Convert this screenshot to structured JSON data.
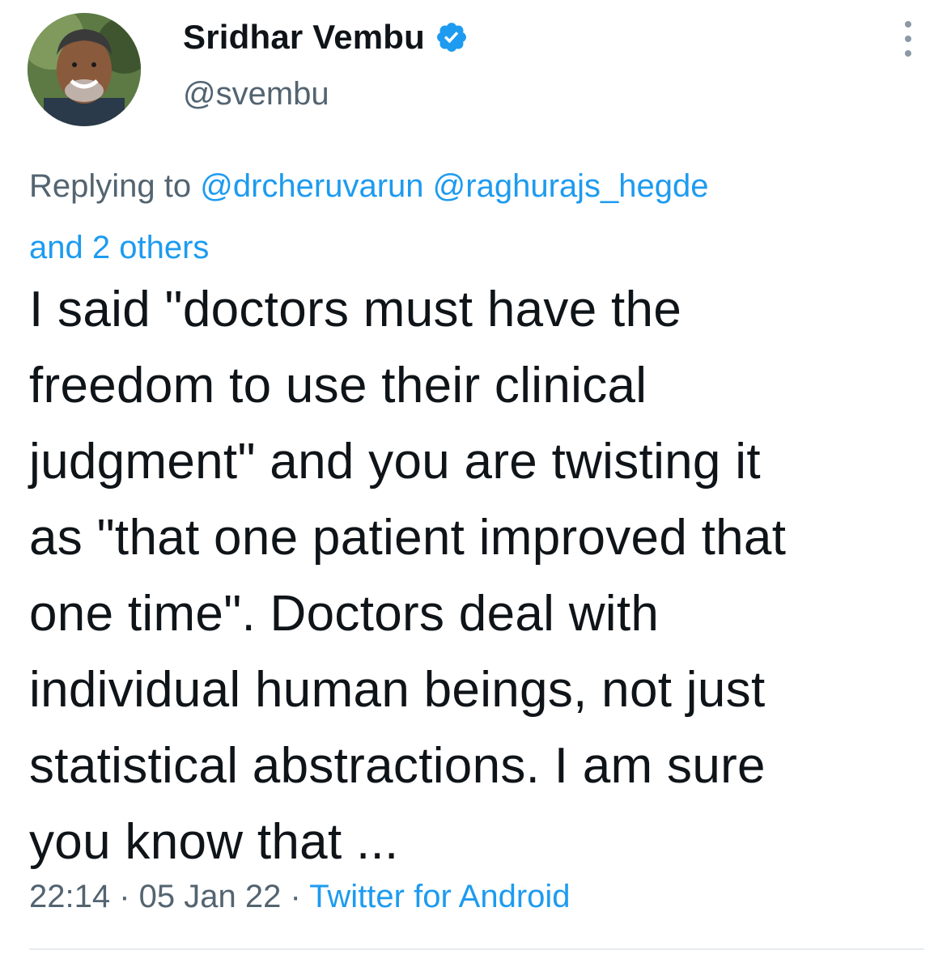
{
  "author": {
    "display_name": "Sridhar Vembu",
    "handle": "@svembu",
    "verified_icon": "verified-badge-icon",
    "verified_color": "#1d9bf0"
  },
  "reply": {
    "prefix": "Replying to ",
    "mentions": [
      "@drcheruvarun",
      "@raghurajs_hegde"
    ],
    "others": "and 2 others"
  },
  "tweet": {
    "lines": [
      "I said \"doctors must have the",
      "freedom to use their clinical",
      "judgment\" and you are twisting it",
      "as \"that one patient improved that",
      "one time\". Doctors deal with",
      "individual human beings, not just",
      "statistical abstractions. I am sure",
      "you know that ..."
    ]
  },
  "meta": {
    "time": "22:14",
    "separator": " · ",
    "date": "05 Jan 22",
    "source": "Twitter for Android"
  },
  "colors": {
    "text": "#0f1419",
    "secondary": "#536471",
    "link": "#1d9bf0"
  }
}
